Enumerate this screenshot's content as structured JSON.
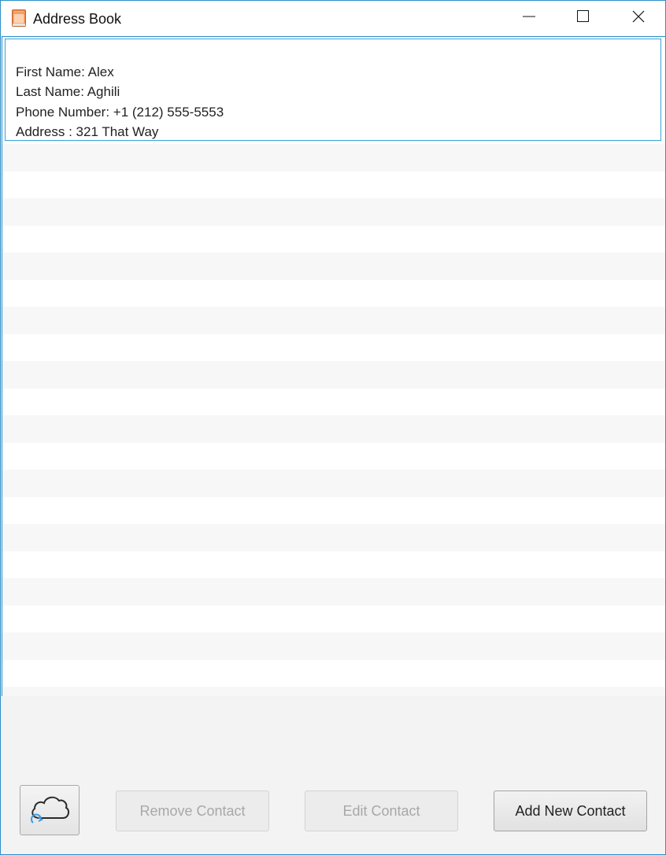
{
  "window": {
    "title": "Address Book",
    "accent_color": "#2b8fc9"
  },
  "titlebar": {
    "app_icon": "address-book-icon",
    "buttons": [
      "minimize-icon",
      "maximize-icon",
      "close-icon"
    ]
  },
  "contacts": [
    {
      "first_name_line": "First Name: Alex",
      "last_name_line": "Last Name: Aghili",
      "phone_line": "Phone Number: +1 (212) 555-5553",
      "address_line": "Address : 321 That Way"
    }
  ],
  "toolbar": {
    "sync_icon": "cloud-sync-icon",
    "remove_label": "Remove Contact",
    "edit_label": "Edit Contact",
    "add_label": "Add New Contact"
  }
}
